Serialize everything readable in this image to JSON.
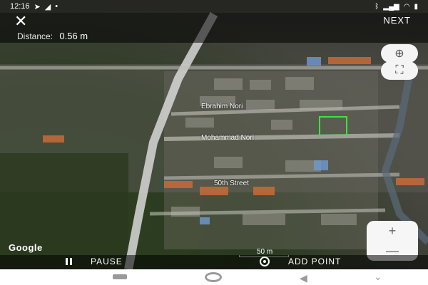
{
  "status_bar": {
    "time": "12:16",
    "left_icons": [
      "location-arrow-icon",
      "send-icon",
      "app-icon"
    ],
    "right_icons": [
      "bluetooth-icon",
      "signal-icon",
      "wifi-icon",
      "battery-icon"
    ]
  },
  "top_bar": {
    "close_label": "✕",
    "next_label": "NEXT",
    "distance_label": "Distance:",
    "distance_value": "0.56 m"
  },
  "map": {
    "street_labels": [
      "Ebrahim Nori",
      "Mohammad Nori",
      "50th Street"
    ],
    "watermark": "Google",
    "scale_label": "50 m",
    "selection_color": "#39e639",
    "road_color": "#d8d8d8",
    "land_color": "#3a3c36"
  },
  "controls": {
    "compass_icon": "compass-icon",
    "fullscreen_icon": "fullscreen-icon",
    "zoom_in": "+",
    "zoom_out": "—"
  },
  "bottom_bar": {
    "pause_label": "PAUSE",
    "add_point_label": "ADD POINT"
  },
  "nav_bar": {
    "back_glyph": "◀",
    "dropdown_glyph": "⌄"
  }
}
